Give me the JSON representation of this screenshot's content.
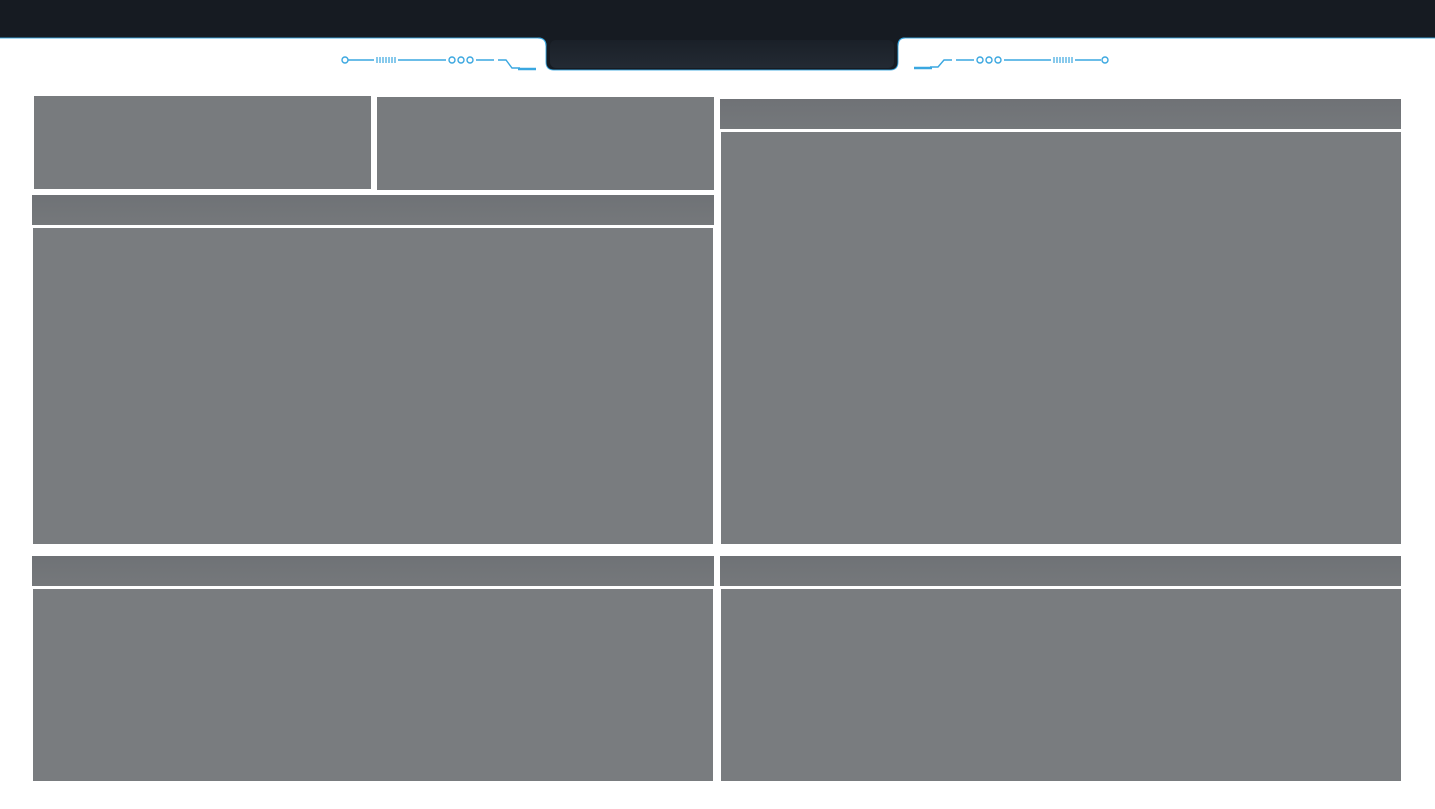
{
  "theme": {
    "header_bg": "#161b22",
    "tab_bg": "#1f252d",
    "accent": "#3aa7e0",
    "panel_bg": "#797c7f",
    "panel_header_bg": "#707377",
    "page_bg": "#ffffff"
  },
  "header": {
    "title": "",
    "decor_icon_left": "circuit-decoration-icon",
    "decor_icon_right": "circuit-decoration-icon"
  },
  "panels": {
    "stat_card_1": {
      "title": ""
    },
    "stat_card_2": {
      "title": ""
    },
    "left_main": {
      "title": ""
    },
    "right_main": {
      "title": ""
    },
    "bottom_left": {
      "title": ""
    },
    "bottom_right": {
      "title": ""
    }
  }
}
